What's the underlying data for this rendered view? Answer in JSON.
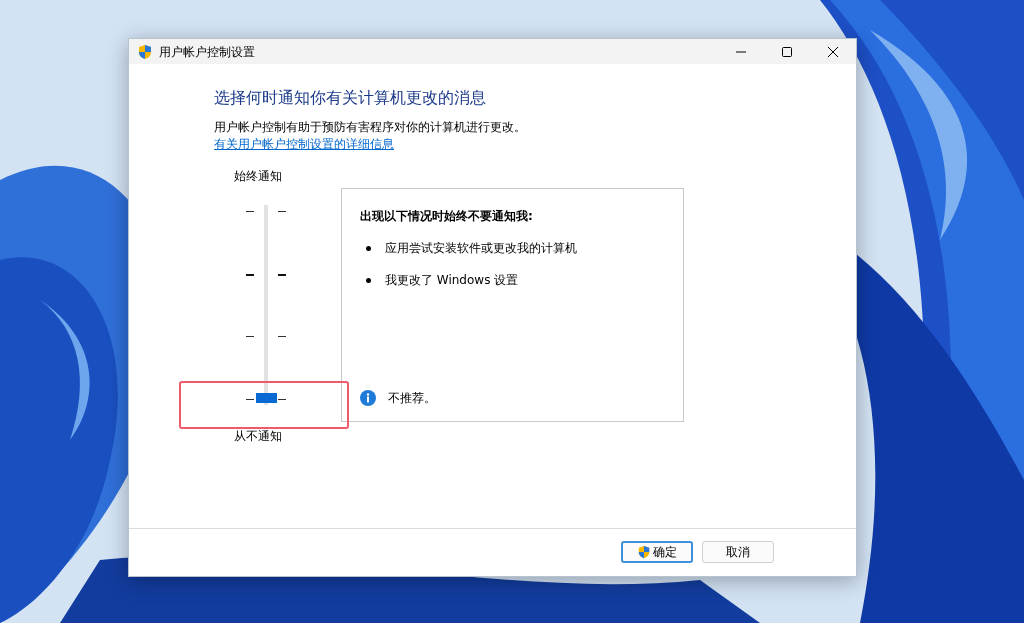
{
  "window": {
    "title": "用户帐户控制设置"
  },
  "heading": "选择何时通知你有关计算机更改的消息",
  "description": "用户帐户控制有助于预防有害程序对你的计算机进行更改。",
  "link": "有关用户帐户控制设置的详细信息",
  "slider": {
    "top_label": "始终通知",
    "bottom_label": "从不通知",
    "level": 0
  },
  "panel": {
    "title": "出现以下情况时始终不要通知我:",
    "items": [
      "应用尝试安装软件或更改我的计算机",
      "我更改了 Windows 设置"
    ],
    "note": "不推荐。"
  },
  "buttons": [
    {
      "label": "确定",
      "shield": true,
      "default": true
    },
    {
      "label": "取消",
      "shield": false,
      "default": false
    }
  ]
}
